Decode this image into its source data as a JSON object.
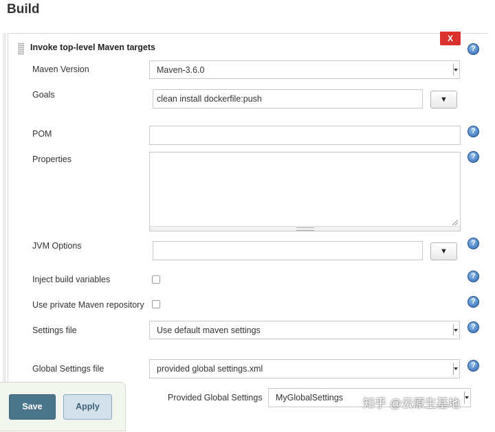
{
  "page": {
    "title": "Build"
  },
  "step": {
    "title": "Invoke top-level Maven targets",
    "delete_label": "X",
    "help_label": "?"
  },
  "fields": {
    "maven_version": {
      "label": "Maven Version",
      "value": "Maven-3.6.0"
    },
    "goals": {
      "label": "Goals",
      "value": "clean install dockerfile:push",
      "expand_label": "▼"
    },
    "pom": {
      "label": "POM",
      "value": ""
    },
    "properties": {
      "label": "Properties",
      "value": ""
    },
    "jvm_options": {
      "label": "JVM Options",
      "value": "",
      "expand_label": "▼"
    },
    "inject_build_variables": {
      "label": "Inject build variables",
      "checked": false
    },
    "use_private_repo": {
      "label": "Use private Maven repository",
      "checked": false
    },
    "settings_file": {
      "label": "Settings file",
      "value": "Use default maven settings"
    },
    "global_settings_file": {
      "label": "Global Settings file",
      "value": "provided global settings.xml"
    },
    "provided_global_settings": {
      "label": "Provided Global Settings",
      "value": "MyGlobalSettings"
    }
  },
  "actions": {
    "save_label": "Save",
    "apply_label": "Apply"
  },
  "watermark": "知乎 @云原生基地"
}
